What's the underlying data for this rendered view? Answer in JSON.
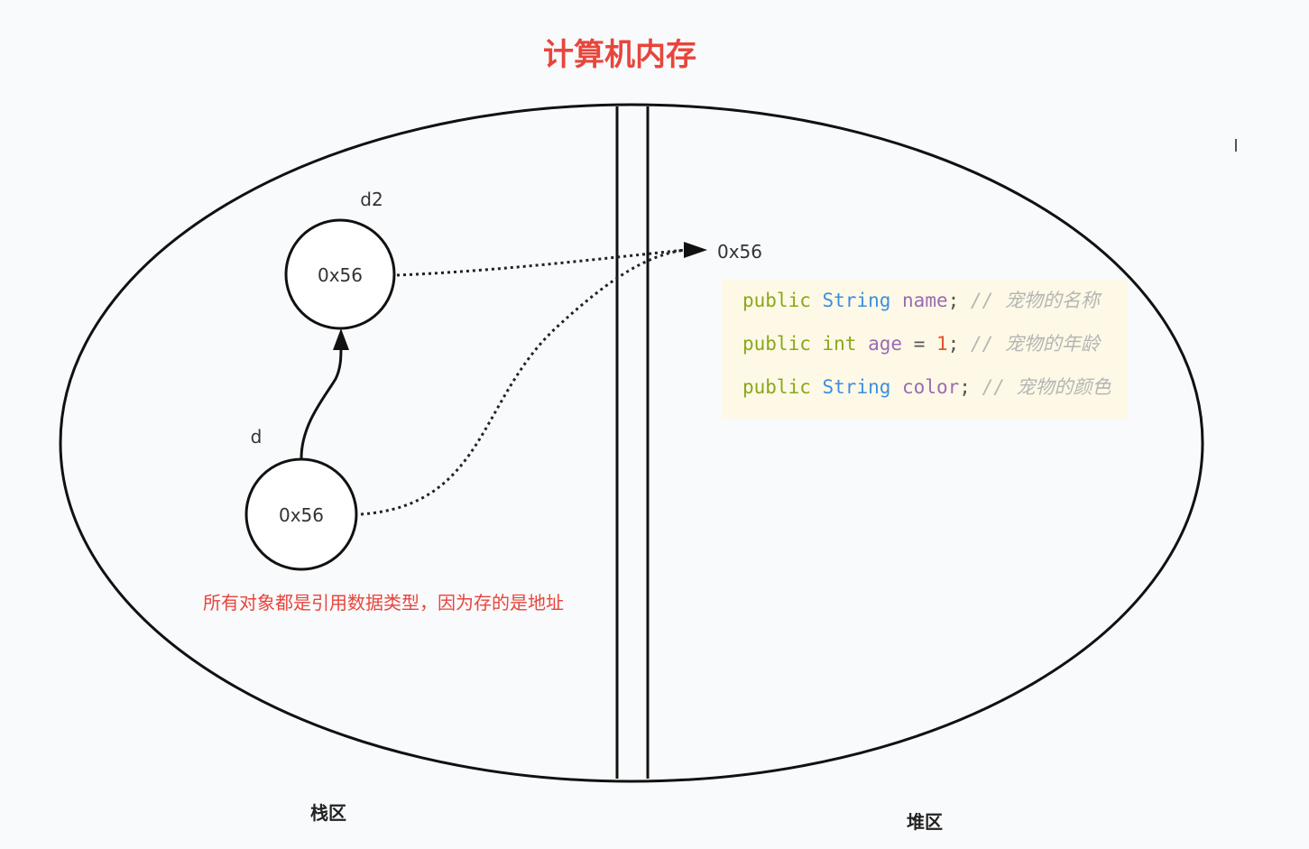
{
  "title": "计算机内存",
  "regions": {
    "stack": "栈区",
    "heap": "堆区"
  },
  "variables": [
    {
      "name": "d2",
      "value": "0x56"
    },
    {
      "name": "d",
      "value": "0x56"
    }
  ],
  "heap_address": "0x56",
  "note": "所有对象都是引用数据类型，因为存的是地址",
  "code": [
    {
      "kw": "public",
      "type": "String",
      "ident": "name",
      "op": "",
      "value": "",
      "end": ";",
      "comment": "// 宠物的名称"
    },
    {
      "kw": "public",
      "type": "int",
      "ident": "age",
      "op": " = ",
      "value": "1",
      "end": ";",
      "comment": "// 宠物的年龄"
    },
    {
      "kw": "public",
      "type": "String",
      "ident": "color",
      "op": "",
      "value": "",
      "end": ";",
      "comment": "// 宠物的颜色"
    }
  ],
  "colors": {
    "title": "#e8453c",
    "note": "#e8453c",
    "code_bg": "#fdf9e6",
    "keyword": "#8ca61b",
    "type": "#3d8ee2",
    "identifier": "#9b6bb3",
    "number": "#e2542e",
    "comment": "#b5b5b5"
  }
}
